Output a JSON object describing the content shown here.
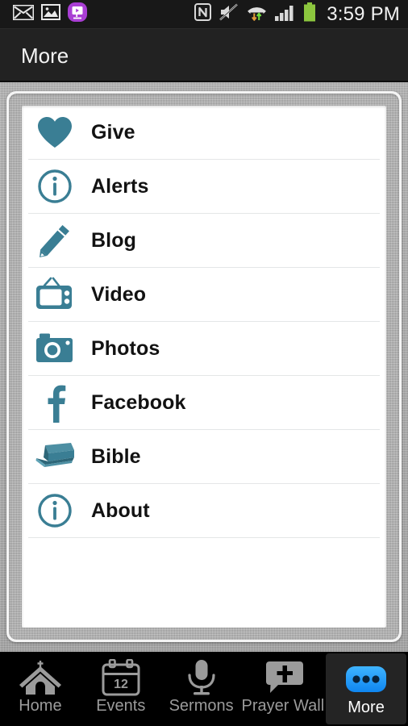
{
  "status_bar": {
    "time": "3:59 PM",
    "left_icons": [
      "email-icon",
      "gallery-image-icon",
      "video-app-icon"
    ],
    "right_icons": [
      "nfc-icon",
      "volume-muted-icon",
      "wifi-data-icon",
      "cellular-signal-icon",
      "battery-icon"
    ],
    "battery_color": "#8cc63e",
    "accent_purple": "#a93ed4"
  },
  "action_bar": {
    "title": "More"
  },
  "menu": {
    "items": [
      {
        "label": "Give",
        "icon": "heart-icon"
      },
      {
        "label": "Alerts",
        "icon": "info-circle-icon"
      },
      {
        "label": "Blog",
        "icon": "pencil-icon"
      },
      {
        "label": "Video",
        "icon": "television-icon"
      },
      {
        "label": "Photos",
        "icon": "camera-icon"
      },
      {
        "label": "Facebook",
        "icon": "facebook-icon"
      },
      {
        "label": "Bible",
        "icon": "book-icon"
      },
      {
        "label": "About",
        "icon": "info-circle-icon"
      }
    ],
    "icon_color": "#3a7e94"
  },
  "tab_bar": {
    "tabs": [
      {
        "label": "Home",
        "icon": "church-icon",
        "active": false
      },
      {
        "label": "Events",
        "icon": "calendar-icon",
        "active": false,
        "badge": "12"
      },
      {
        "label": "Sermons",
        "icon": "microphone-icon",
        "active": false
      },
      {
        "label": "Prayer Wall",
        "icon": "prayer-cross-icon",
        "active": false
      },
      {
        "label": "More",
        "icon": "more-dots-icon",
        "active": true
      }
    ],
    "active_icon_color": "#2196f3",
    "inactive_icon_color": "#9b9b9b"
  }
}
